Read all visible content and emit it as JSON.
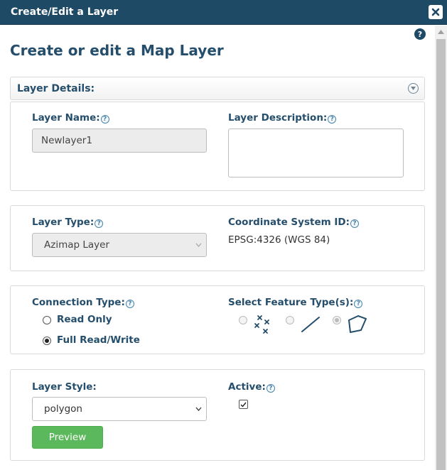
{
  "window": {
    "title": "Create/Edit a Layer"
  },
  "page": {
    "title": "Create or edit a Map Layer",
    "help_icon": "?"
  },
  "section": {
    "label": "Layer Details:"
  },
  "details": {
    "layer_name_label": "Layer Name:",
    "layer_name_value": "Newlayer1",
    "layer_description_label": "Layer Description:",
    "layer_description_value": ""
  },
  "type": {
    "layer_type_label": "Layer Type:",
    "layer_type_value": "Azimap Layer",
    "coordinate_label": "Coordinate System ID:",
    "coordinate_value": "EPSG:4326 (WGS 84)"
  },
  "connection": {
    "label": "Connection Type:",
    "options": [
      {
        "label": "Read Only",
        "checked": false
      },
      {
        "label": "Full Read/Write",
        "checked": true
      }
    ],
    "feature_label": "Select Feature Type(s):",
    "feature_types": [
      {
        "icon": "points-icon",
        "checked": false
      },
      {
        "icon": "line-icon",
        "checked": false
      },
      {
        "icon": "polygon-icon",
        "checked": true
      }
    ]
  },
  "style": {
    "layer_style_label": "Layer Style:",
    "layer_style_value": "polygon",
    "active_label": "Active:",
    "active_checked": true,
    "preview_label": "Preview"
  },
  "help_glyph": "?",
  "colors": {
    "title_bar": "#1e4a66",
    "heading": "#244e6b",
    "preview_button": "#5cb85c"
  }
}
